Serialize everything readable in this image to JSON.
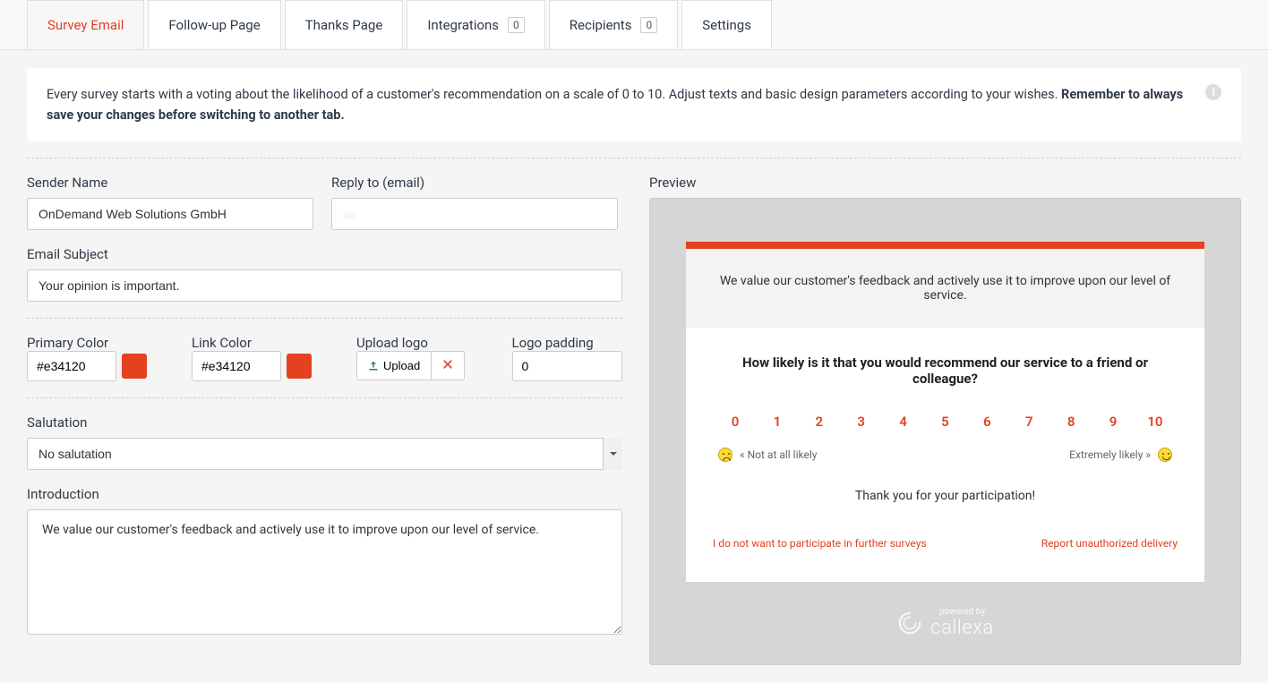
{
  "tabs": [
    {
      "label": "Survey Email",
      "active": true
    },
    {
      "label": "Follow-up Page"
    },
    {
      "label": "Thanks Page"
    },
    {
      "label": "Integrations",
      "badge": "0"
    },
    {
      "label": "Recipients",
      "badge": "0"
    },
    {
      "label": "Settings"
    }
  ],
  "info": {
    "text": "Every survey starts with a voting about the likelihood of a customer's recommendation on a scale of 0 to 10. Adjust texts and basic design parameters according to your wishes. ",
    "bold": "Remember to always save your changes before switching to another tab."
  },
  "form": {
    "sender_name_label": "Sender Name",
    "sender_name_value": "OnDemand Web Solutions GmbH",
    "reply_to_label": "Reply to (email)",
    "reply_to_value": "—",
    "subject_label": "Email Subject",
    "subject_value": "Your opinion is important.",
    "primary_color_label": "Primary Color",
    "primary_color_value": "#e34120",
    "link_color_label": "Link Color",
    "link_color_value": "#e34120",
    "upload_logo_label": "Upload logo",
    "upload_btn": "Upload",
    "logo_padding_label": "Logo padding",
    "logo_padding_value": "0",
    "salutation_label": "Salutation",
    "salutation_value": "No salutation",
    "introduction_label": "Introduction",
    "introduction_value": "We value our customer's feedback and actively use it to improve upon our level of service."
  },
  "preview": {
    "label": "Preview",
    "header": "We value our customer's feedback and actively use it to improve upon our level of service.",
    "question": "How likely is it that you would recommend our service to a friend or colleague?",
    "scores": [
      "0",
      "1",
      "2",
      "3",
      "4",
      "5",
      "6",
      "7",
      "8",
      "9",
      "10"
    ],
    "low_label": "« Not at all likely",
    "high_label": "Extremely likely »",
    "thanks": "Thank you for your participation!",
    "optout": "I do not want to participate in further surveys",
    "report": "Report unauthorized delivery",
    "powered_small": "powered by",
    "powered_brand": "callexa"
  },
  "colors": {
    "accent": "#e34120"
  }
}
